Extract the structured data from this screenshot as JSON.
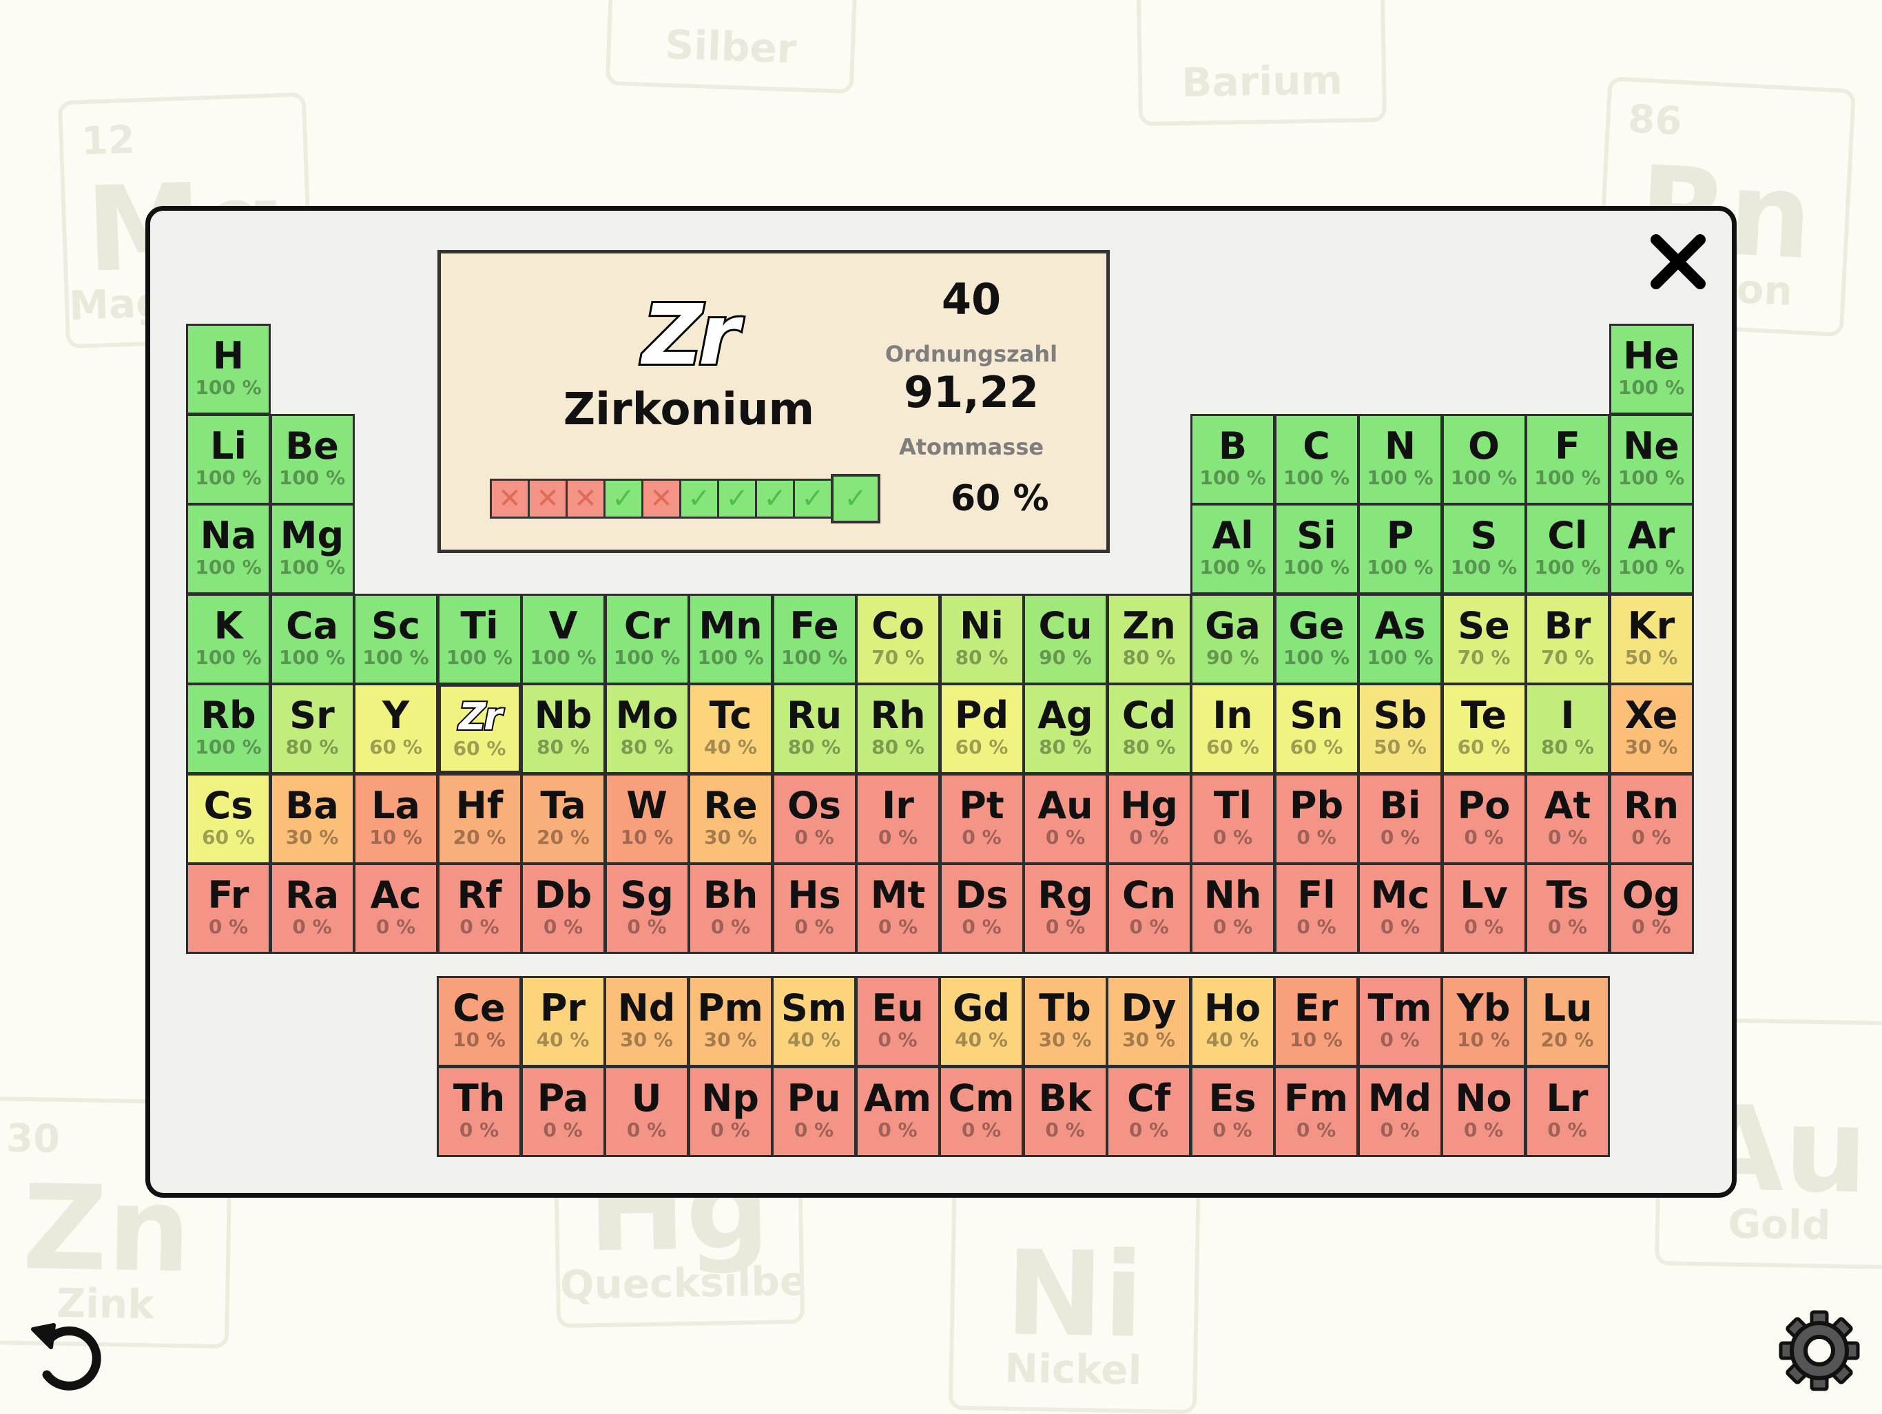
{
  "background_cards": [
    {
      "number": "",
      "symbol": "",
      "name": "Silber"
    },
    {
      "number": "",
      "symbol": "",
      "name": "Barium"
    },
    {
      "number": "12",
      "symbol": "Mg",
      "name": "Magnesium"
    },
    {
      "number": "86",
      "symbol": "Rn",
      "name": "Radon"
    },
    {
      "number": "30",
      "symbol": "Zn",
      "name": "Zink"
    },
    {
      "number": "",
      "symbol": "Hg",
      "name": "Quecksilber"
    },
    {
      "number": "",
      "symbol": "Ni",
      "name": "Nickel"
    },
    {
      "number": "",
      "symbol": "Au",
      "name": "Gold"
    }
  ],
  "info": {
    "symbol": "Zr",
    "name": "Zirkonium",
    "atomic_number": "40",
    "atomic_number_label": "Ordnungszahl",
    "atomic_mass": "91,22",
    "atomic_mass_label": "Atommasse",
    "percent": "60 %",
    "attempts": [
      "wrong",
      "wrong",
      "wrong",
      "right",
      "wrong",
      "right",
      "right",
      "right",
      "right",
      "right"
    ]
  },
  "colors": {
    "c100": "#86e57b",
    "c90": "#9fe879",
    "c80": "#c2ec7c",
    "c70": "#dcf07f",
    "c60": "#f0f380",
    "c50": "#f6e57e",
    "c40": "#fbd47c",
    "c30": "#fbbf77",
    "c20": "#f9af79",
    "c10": "#f8a07b",
    "c0": "#f39486"
  },
  "elements": [
    {
      "s": "H",
      "p": "100 %",
      "r": 1,
      "c": 1
    },
    {
      "s": "He",
      "p": "100 %",
      "r": 1,
      "c": 18
    },
    {
      "s": "Li",
      "p": "100 %",
      "r": 2,
      "c": 1
    },
    {
      "s": "Be",
      "p": "100 %",
      "r": 2,
      "c": 2
    },
    {
      "s": "B",
      "p": "100 %",
      "r": 2,
      "c": 13
    },
    {
      "s": "C",
      "p": "100 %",
      "r": 2,
      "c": 14
    },
    {
      "s": "N",
      "p": "100 %",
      "r": 2,
      "c": 15
    },
    {
      "s": "O",
      "p": "100 %",
      "r": 2,
      "c": 16
    },
    {
      "s": "F",
      "p": "100 %",
      "r": 2,
      "c": 17
    },
    {
      "s": "Ne",
      "p": "100 %",
      "r": 2,
      "c": 18
    },
    {
      "s": "Na",
      "p": "100 %",
      "r": 3,
      "c": 1
    },
    {
      "s": "Mg",
      "p": "100 %",
      "r": 3,
      "c": 2
    },
    {
      "s": "Al",
      "p": "100 %",
      "r": 3,
      "c": 13
    },
    {
      "s": "Si",
      "p": "100 %",
      "r": 3,
      "c": 14
    },
    {
      "s": "P",
      "p": "100 %",
      "r": 3,
      "c": 15
    },
    {
      "s": "S",
      "p": "100 %",
      "r": 3,
      "c": 16
    },
    {
      "s": "Cl",
      "p": "100 %",
      "r": 3,
      "c": 17
    },
    {
      "s": "Ar",
      "p": "100 %",
      "r": 3,
      "c": 18
    },
    {
      "s": "K",
      "p": "100 %",
      "r": 4,
      "c": 1
    },
    {
      "s": "Ca",
      "p": "100 %",
      "r": 4,
      "c": 2
    },
    {
      "s": "Sc",
      "p": "100 %",
      "r": 4,
      "c": 3
    },
    {
      "s": "Ti",
      "p": "100 %",
      "r": 4,
      "c": 4
    },
    {
      "s": "V",
      "p": "100 %",
      "r": 4,
      "c": 5
    },
    {
      "s": "Cr",
      "p": "100 %",
      "r": 4,
      "c": 6
    },
    {
      "s": "Mn",
      "p": "100 %",
      "r": 4,
      "c": 7
    },
    {
      "s": "Fe",
      "p": "100 %",
      "r": 4,
      "c": 8
    },
    {
      "s": "Co",
      "p": "70 %",
      "r": 4,
      "c": 9
    },
    {
      "s": "Ni",
      "p": "80 %",
      "r": 4,
      "c": 10
    },
    {
      "s": "Cu",
      "p": "90 %",
      "r": 4,
      "c": 11
    },
    {
      "s": "Zn",
      "p": "80 %",
      "r": 4,
      "c": 12
    },
    {
      "s": "Ga",
      "p": "90 %",
      "r": 4,
      "c": 13
    },
    {
      "s": "Ge",
      "p": "100 %",
      "r": 4,
      "c": 14
    },
    {
      "s": "As",
      "p": "100 %",
      "r": 4,
      "c": 15
    },
    {
      "s": "Se",
      "p": "70 %",
      "r": 4,
      "c": 16
    },
    {
      "s": "Br",
      "p": "70 %",
      "r": 4,
      "c": 17
    },
    {
      "s": "Kr",
      "p": "50 %",
      "r": 4,
      "c": 18
    },
    {
      "s": "Rb",
      "p": "100 %",
      "r": 5,
      "c": 1
    },
    {
      "s": "Sr",
      "p": "80 %",
      "r": 5,
      "c": 2
    },
    {
      "s": "Y",
      "p": "60 %",
      "r": 5,
      "c": 3
    },
    {
      "s": "Zr",
      "p": "60 %",
      "r": 5,
      "c": 4,
      "sel": true
    },
    {
      "s": "Nb",
      "p": "80 %",
      "r": 5,
      "c": 5
    },
    {
      "s": "Mo",
      "p": "80 %",
      "r": 5,
      "c": 6
    },
    {
      "s": "Tc",
      "p": "40 %",
      "r": 5,
      "c": 7
    },
    {
      "s": "Ru",
      "p": "80 %",
      "r": 5,
      "c": 8
    },
    {
      "s": "Rh",
      "p": "80 %",
      "r": 5,
      "c": 9
    },
    {
      "s": "Pd",
      "p": "60 %",
      "r": 5,
      "c": 10
    },
    {
      "s": "Ag",
      "p": "80 %",
      "r": 5,
      "c": 11
    },
    {
      "s": "Cd",
      "p": "80 %",
      "r": 5,
      "c": 12
    },
    {
      "s": "In",
      "p": "60 %",
      "r": 5,
      "c": 13
    },
    {
      "s": "Sn",
      "p": "60 %",
      "r": 5,
      "c": 14
    },
    {
      "s": "Sb",
      "p": "50 %",
      "r": 5,
      "c": 15
    },
    {
      "s": "Te",
      "p": "60 %",
      "r": 5,
      "c": 16
    },
    {
      "s": "I",
      "p": "80 %",
      "r": 5,
      "c": 17
    },
    {
      "s": "Xe",
      "p": "30 %",
      "r": 5,
      "c": 18
    },
    {
      "s": "Cs",
      "p": "60 %",
      "r": 6,
      "c": 1
    },
    {
      "s": "Ba",
      "p": "30 %",
      "r": 6,
      "c": 2
    },
    {
      "s": "La",
      "p": "10 %",
      "r": 6,
      "c": 3
    },
    {
      "s": "Hf",
      "p": "20 %",
      "r": 6,
      "c": 4
    },
    {
      "s": "Ta",
      "p": "20 %",
      "r": 6,
      "c": 5
    },
    {
      "s": "W",
      "p": "10 %",
      "r": 6,
      "c": 6
    },
    {
      "s": "Re",
      "p": "30 %",
      "r": 6,
      "c": 7
    },
    {
      "s": "Os",
      "p": "0 %",
      "r": 6,
      "c": 8
    },
    {
      "s": "Ir",
      "p": "0 %",
      "r": 6,
      "c": 9
    },
    {
      "s": "Pt",
      "p": "0 %",
      "r": 6,
      "c": 10
    },
    {
      "s": "Au",
      "p": "0 %",
      "r": 6,
      "c": 11
    },
    {
      "s": "Hg",
      "p": "0 %",
      "r": 6,
      "c": 12
    },
    {
      "s": "Tl",
      "p": "0 %",
      "r": 6,
      "c": 13
    },
    {
      "s": "Pb",
      "p": "0 %",
      "r": 6,
      "c": 14
    },
    {
      "s": "Bi",
      "p": "0 %",
      "r": 6,
      "c": 15
    },
    {
      "s": "Po",
      "p": "0 %",
      "r": 6,
      "c": 16
    },
    {
      "s": "At",
      "p": "0 %",
      "r": 6,
      "c": 17
    },
    {
      "s": "Rn",
      "p": "0 %",
      "r": 6,
      "c": 18
    },
    {
      "s": "Fr",
      "p": "0 %",
      "r": 7,
      "c": 1
    },
    {
      "s": "Ra",
      "p": "0 %",
      "r": 7,
      "c": 2
    },
    {
      "s": "Ac",
      "p": "0 %",
      "r": 7,
      "c": 3
    },
    {
      "s": "Rf",
      "p": "0 %",
      "r": 7,
      "c": 4
    },
    {
      "s": "Db",
      "p": "0 %",
      "r": 7,
      "c": 5
    },
    {
      "s": "Sg",
      "p": "0 %",
      "r": 7,
      "c": 6
    },
    {
      "s": "Bh",
      "p": "0 %",
      "r": 7,
      "c": 7
    },
    {
      "s": "Hs",
      "p": "0 %",
      "r": 7,
      "c": 8
    },
    {
      "s": "Mt",
      "p": "0 %",
      "r": 7,
      "c": 9
    },
    {
      "s": "Ds",
      "p": "0 %",
      "r": 7,
      "c": 10
    },
    {
      "s": "Rg",
      "p": "0 %",
      "r": 7,
      "c": 11
    },
    {
      "s": "Cn",
      "p": "0 %",
      "r": 7,
      "c": 12
    },
    {
      "s": "Nh",
      "p": "0 %",
      "r": 7,
      "c": 13
    },
    {
      "s": "Fl",
      "p": "0 %",
      "r": 7,
      "c": 14
    },
    {
      "s": "Mc",
      "p": "0 %",
      "r": 7,
      "c": 15
    },
    {
      "s": "Lv",
      "p": "0 %",
      "r": 7,
      "c": 16
    },
    {
      "s": "Ts",
      "p": "0 %",
      "r": 7,
      "c": 17
    },
    {
      "s": "Og",
      "p": "0 %",
      "r": 7,
      "c": 18
    }
  ],
  "f_block": [
    {
      "s": "Ce",
      "p": "10 %",
      "r": 1,
      "c": 1
    },
    {
      "s": "Pr",
      "p": "40 %",
      "r": 1,
      "c": 2
    },
    {
      "s": "Nd",
      "p": "30 %",
      "r": 1,
      "c": 3
    },
    {
      "s": "Pm",
      "p": "30 %",
      "r": 1,
      "c": 4
    },
    {
      "s": "Sm",
      "p": "40 %",
      "r": 1,
      "c": 5
    },
    {
      "s": "Eu",
      "p": "0 %",
      "r": 1,
      "c": 6
    },
    {
      "s": "Gd",
      "p": "40 %",
      "r": 1,
      "c": 7
    },
    {
      "s": "Tb",
      "p": "30 %",
      "r": 1,
      "c": 8
    },
    {
      "s": "Dy",
      "p": "30 %",
      "r": 1,
      "c": 9
    },
    {
      "s": "Ho",
      "p": "40 %",
      "r": 1,
      "c": 10
    },
    {
      "s": "Er",
      "p": "10 %",
      "r": 1,
      "c": 11
    },
    {
      "s": "Tm",
      "p": "0 %",
      "r": 1,
      "c": 12
    },
    {
      "s": "Yb",
      "p": "10 %",
      "r": 1,
      "c": 13
    },
    {
      "s": "Lu",
      "p": "20 %",
      "r": 1,
      "c": 14
    },
    {
      "s": "Th",
      "p": "0 %",
      "r": 2,
      "c": 1
    },
    {
      "s": "Pa",
      "p": "0 %",
      "r": 2,
      "c": 2
    },
    {
      "s": "U",
      "p": "0 %",
      "r": 2,
      "c": 3
    },
    {
      "s": "Np",
      "p": "0 %",
      "r": 2,
      "c": 4
    },
    {
      "s": "Pu",
      "p": "0 %",
      "r": 2,
      "c": 5
    },
    {
      "s": "Am",
      "p": "0 %",
      "r": 2,
      "c": 6
    },
    {
      "s": "Cm",
      "p": "0 %",
      "r": 2,
      "c": 7
    },
    {
      "s": "Bk",
      "p": "0 %",
      "r": 2,
      "c": 8
    },
    {
      "s": "Cf",
      "p": "0 %",
      "r": 2,
      "c": 9
    },
    {
      "s": "Es",
      "p": "0 %",
      "r": 2,
      "c": 10
    },
    {
      "s": "Fm",
      "p": "0 %",
      "r": 2,
      "c": 11
    },
    {
      "s": "Md",
      "p": "0 %",
      "r": 2,
      "c": 12
    },
    {
      "s": "No",
      "p": "0 %",
      "r": 2,
      "c": 13
    },
    {
      "s": "Lr",
      "p": "0 %",
      "r": 2,
      "c": 14
    }
  ],
  "icons": {
    "close": "close-icon",
    "undo": "undo-icon",
    "settings": "gear-icon"
  }
}
